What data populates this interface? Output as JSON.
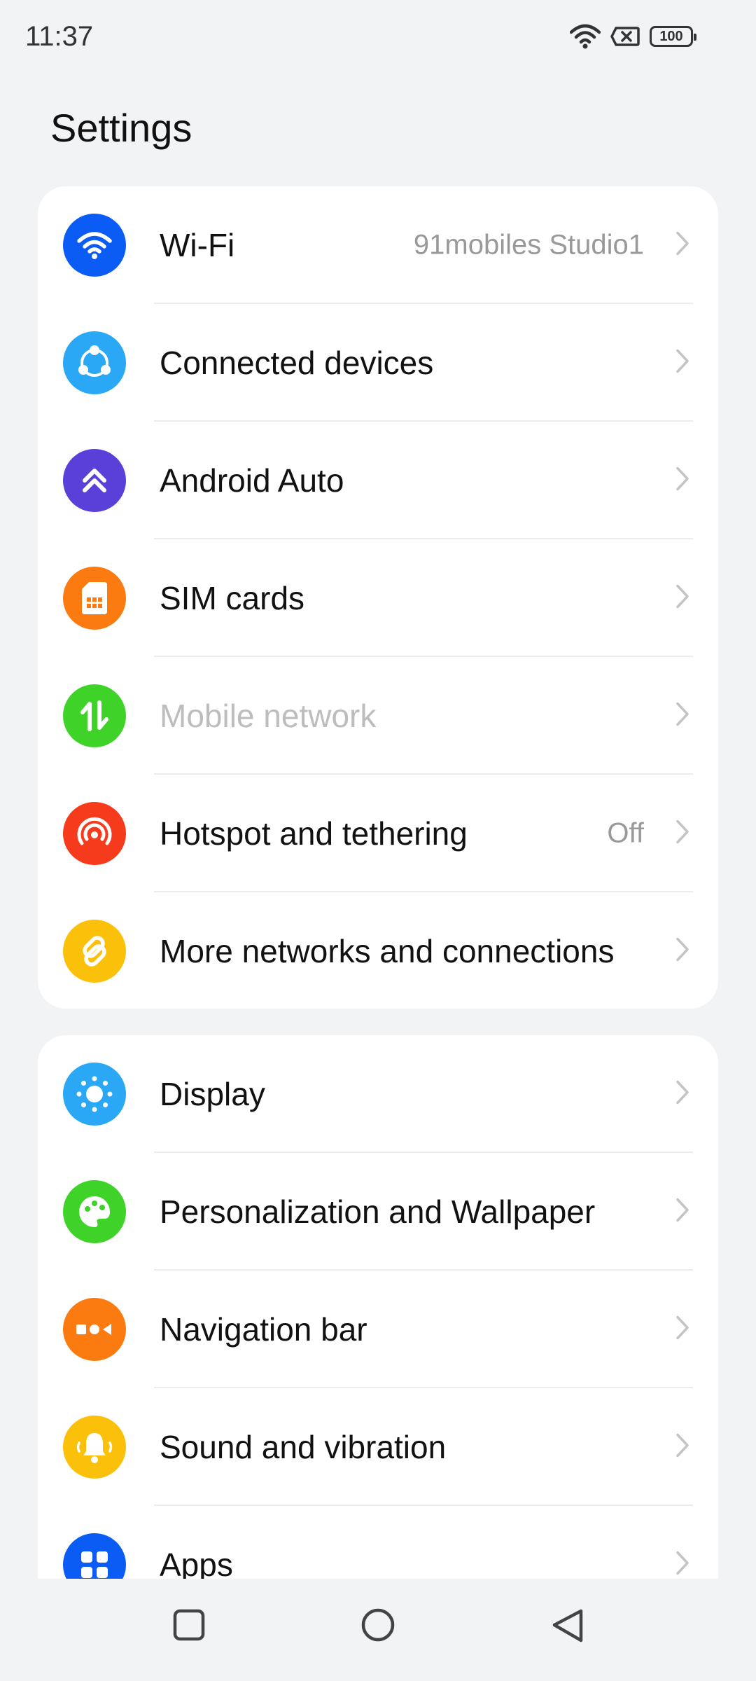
{
  "status_bar": {
    "time": "11:37",
    "battery": "100"
  },
  "page_title": "Settings",
  "groups": [
    {
      "items": [
        {
          "label": "Wi-Fi",
          "value": "91mobiles Studio1",
          "icon": "wifi-icon",
          "color": "#0a5cf5"
        },
        {
          "label": "Connected devices",
          "value": "",
          "icon": "connected-devices-icon",
          "color": "#2aa8f5"
        },
        {
          "label": "Android Auto",
          "value": "",
          "icon": "android-auto-icon",
          "color": "#5a3fd8"
        },
        {
          "label": "SIM cards",
          "value": "",
          "icon": "sim-card-icon",
          "color": "#fb7b10"
        },
        {
          "label": "Mobile network",
          "value": "",
          "icon": "mobile-network-icon",
          "color": "#3fd329",
          "disabled": true
        },
        {
          "label": "Hotspot and tethering",
          "value": "Off",
          "icon": "hotspot-icon",
          "color": "#f63a1c"
        },
        {
          "label": "More networks and connections",
          "value": "",
          "icon": "link-icon",
          "color": "#fbc10a"
        }
      ]
    },
    {
      "items": [
        {
          "label": "Display",
          "value": "",
          "icon": "display-icon",
          "color": "#2aa8f5"
        },
        {
          "label": "Personalization and Wallpaper",
          "value": "",
          "icon": "palette-icon",
          "color": "#3fd329"
        },
        {
          "label": "Navigation bar",
          "value": "",
          "icon": "navigation-bar-icon",
          "color": "#fb7b10"
        },
        {
          "label": "Sound and vibration",
          "value": "",
          "icon": "bell-icon",
          "color": "#fbc10a"
        },
        {
          "label": "Apps",
          "value": "",
          "icon": "apps-icon",
          "color": "#0a5cf5"
        }
      ]
    }
  ]
}
